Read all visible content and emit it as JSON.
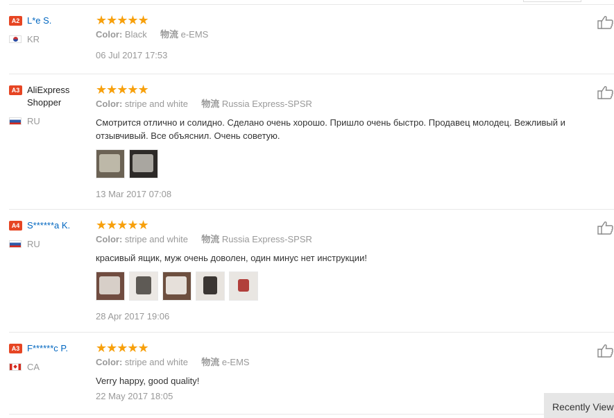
{
  "reviews": [
    {
      "level": "A2",
      "name": "L*e S.",
      "country": "KR",
      "stars": "★★★★★",
      "color_label": "Color:",
      "color": "Black",
      "shipping_label": "物流",
      "shipping": "e-EMS",
      "text": "",
      "date": "06 Jul 2017 17:53"
    },
    {
      "level": "A3",
      "name": "AliExpress Shopper",
      "country": "RU",
      "stars": "★★★★★",
      "color_label": "Color:",
      "color": "stripe and white",
      "shipping_label": "物流",
      "shipping": "Russia Express-SPSR",
      "text": "Смотрится отлично и солидно. Сделано очень хорошо. Пришло очень быстро. Продавец молодец. Вежливый и отзывчивый. Все объяснил. Очень советую.",
      "date": "13 Mar 2017 07:08"
    },
    {
      "level": "A4",
      "name": "S******a K.",
      "country": "RU",
      "stars": "★★★★★",
      "color_label": "Color:",
      "color": "stripe and white",
      "shipping_label": "物流",
      "shipping": "Russia Express-SPSR",
      "text": "красивый ящик, муж очень доволен, один минус нет инструкции!",
      "date": "28 Apr 2017 19:06"
    },
    {
      "level": "A3",
      "name": "F******c P.",
      "country": "CA",
      "stars": "★★★★★",
      "color_label": "Color:",
      "color": "stripe and white",
      "shipping_label": "物流",
      "shipping": "e-EMS",
      "text": "Verry happy, good quality!",
      "date": "22 May 2017 18:05"
    }
  ],
  "recently_viewed": "Recently Viewed"
}
